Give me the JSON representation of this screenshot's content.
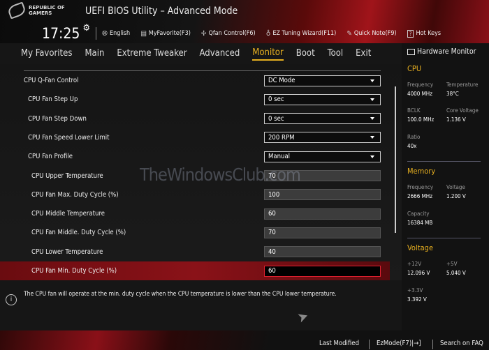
{
  "header": {
    "logo_text": "REPUBLIC OF GAMERS",
    "title": "UEFI BIOS Utility – Advanced Mode"
  },
  "toolbar": {
    "time": "17:25",
    "items": [
      {
        "icon": "globe-icon",
        "label": "English"
      },
      {
        "icon": "favorite-list-icon",
        "label": "MyFavorite(F3)"
      },
      {
        "icon": "fan-icon",
        "label": "Qfan Control(F6)"
      },
      {
        "icon": "lightbulb-icon",
        "label": "EZ Tuning Wizard(F11)"
      },
      {
        "icon": "note-icon",
        "label": "Quick Note(F9)"
      },
      {
        "icon": "question-icon",
        "label": "Hot Keys"
      }
    ]
  },
  "nav": {
    "tabs": [
      "My Favorites",
      "Main",
      "Extreme Tweaker",
      "Advanced",
      "Monitor",
      "Boot",
      "Tool",
      "Exit"
    ],
    "active": "Monitor"
  },
  "settings": [
    {
      "label": "CPU Q-Fan Control",
      "value": "DC Mode",
      "type": "dropdown",
      "level": 0
    },
    {
      "label": "CPU Fan Step Up",
      "value": "0 sec",
      "type": "dropdown",
      "level": 1
    },
    {
      "label": "CPU Fan Step Down",
      "value": "0 sec",
      "type": "dropdown",
      "level": 1
    },
    {
      "label": "CPU Fan Speed Lower Limit",
      "value": "200 RPM",
      "type": "dropdown",
      "level": 1
    },
    {
      "label": "CPU Fan Profile",
      "value": "Manual",
      "type": "dropdown",
      "level": 1
    },
    {
      "label": "CPU Upper Temperature",
      "value": "70",
      "type": "input",
      "level": 2
    },
    {
      "label": "CPU Fan Max. Duty Cycle (%)",
      "value": "100",
      "type": "input",
      "level": 2
    },
    {
      "label": "CPU Middle Temperature",
      "value": "60",
      "type": "input",
      "level": 2
    },
    {
      "label": "CPU Fan Middle. Duty Cycle (%)",
      "value": "70",
      "type": "input",
      "level": 2
    },
    {
      "label": "CPU Lower Temperature",
      "value": "40",
      "type": "input",
      "level": 2
    },
    {
      "label": "CPU Fan Min. Duty Cycle (%)",
      "value": "60",
      "type": "input",
      "level": 2,
      "selected": true
    }
  ],
  "info": "The CPU fan will operate at the min. duty cycle when the CPU temperature is lower than the CPU lower temperature.",
  "watermark": "TheWindowsClub.com",
  "footer": {
    "last_modified": "Last Modified",
    "ezmode": "EzMode(F7)|→]",
    "faq": "Search on FAQ"
  },
  "hw": {
    "title": "Hardware Monitor",
    "cpu": {
      "title": "CPU",
      "freq_k": "Frequency",
      "freq": "4000 MHz",
      "temp_k": "Temperature",
      "temp": "38°C",
      "bclk_k": "BCLK",
      "bclk": "100.0 MHz",
      "cv_k": "Core Voltage",
      "cv": "1.136 V",
      "ratio_k": "Ratio",
      "ratio": "40x"
    },
    "mem": {
      "title": "Memory",
      "freq_k": "Frequency",
      "freq": "2666 MHz",
      "volt_k": "Voltage",
      "volt": "1.200 V",
      "cap_k": "Capacity",
      "cap": "16384 MB"
    },
    "volt": {
      "title": "Voltage",
      "v12_k": "+12V",
      "v12": "12.096 V",
      "v5_k": "+5V",
      "v5": "5.040 V",
      "v33_k": "+3.3V",
      "v33": "3.392 V"
    }
  },
  "colors": {
    "accent": "#e8b020",
    "selected_row": "#8a1218",
    "active_input_border": "#e02030"
  }
}
